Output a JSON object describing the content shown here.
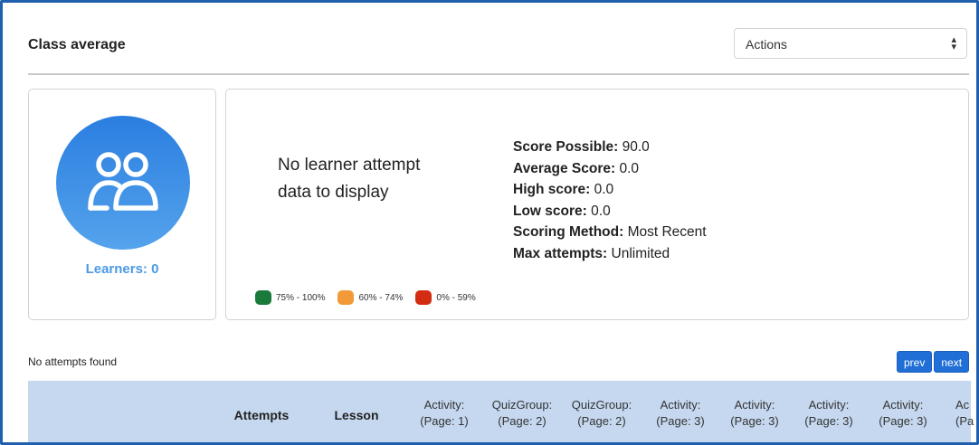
{
  "header": {
    "title": "Class average"
  },
  "actions": {
    "label": "Actions",
    "caret": "⇕"
  },
  "learners": {
    "label": "Learners: 0"
  },
  "summary": {
    "no_data_line1": "No learner attempt",
    "no_data_line2": "data to display",
    "stats": [
      {
        "label": "Score Possible:",
        "value": "90.0"
      },
      {
        "label": "Average Score:",
        "value": "0.0"
      },
      {
        "label": "High score:",
        "value": "0.0"
      },
      {
        "label": "Low score:",
        "value": "0.0"
      },
      {
        "label": "Scoring Method:",
        "value": "Most Recent"
      },
      {
        "label": "Max attempts:",
        "value": "Unlimited"
      }
    ],
    "legend": [
      {
        "label": "75% - 100%",
        "color": "#1a7a3c"
      },
      {
        "label": "60% - 74%",
        "color": "#f29a38"
      },
      {
        "label": "0% - 59%",
        "color": "#d22d12"
      }
    ]
  },
  "attempts": {
    "empty_text": "No attempts found"
  },
  "pager": {
    "prev": "prev",
    "next": "next"
  },
  "table": {
    "columns": [
      {
        "line1": "Attempts",
        "line2": ""
      },
      {
        "line1": "Lesson",
        "line2": ""
      },
      {
        "line1": "Activity:",
        "line2": "(Page: 1)"
      },
      {
        "line1": "QuizGroup:",
        "line2": "(Page: 2)"
      },
      {
        "line1": "QuizGroup:",
        "line2": "(Page: 2)"
      },
      {
        "line1": "Activity:",
        "line2": "(Page: 3)"
      },
      {
        "line1": "Activity:",
        "line2": "(Page: 3)"
      },
      {
        "line1": "Activity:",
        "line2": "(Page: 3)"
      },
      {
        "line1": "Activity:",
        "line2": "(Page: 3)"
      },
      {
        "line1": "Ac",
        "line2": "(Pa"
      }
    ]
  }
}
